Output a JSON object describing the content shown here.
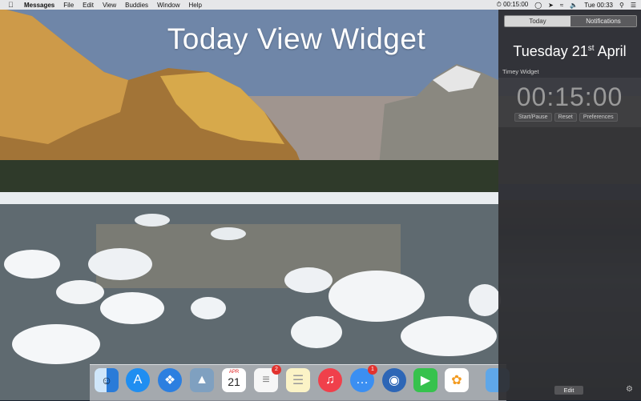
{
  "menubar": {
    "app_name": "Messages",
    "menus": [
      "File",
      "Edit",
      "View",
      "Buddies",
      "Window",
      "Help"
    ],
    "timer_status": "00:15:00",
    "clock": "Tue 00:33"
  },
  "desktop": {
    "title": "Today View Widget"
  },
  "notification_center": {
    "tabs": [
      "Today",
      "Notifications"
    ],
    "date_prefix": "Tuesday 21",
    "date_suffix": "st",
    "date_month": "April",
    "widget": {
      "title": "Timey Widget",
      "timer": "00:15:00",
      "buttons": [
        "Start/Pause",
        "Reset",
        "Preferences"
      ]
    },
    "edit_label": "Edit"
  },
  "dock": {
    "calendar_month": "APR",
    "calendar_day": "21",
    "reminders_badge": "2",
    "messages_badge": "1"
  }
}
